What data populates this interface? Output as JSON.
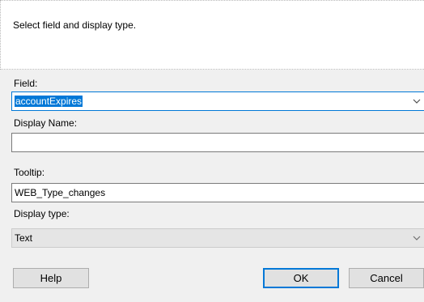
{
  "header": {
    "instruction": "Select field and display type."
  },
  "form": {
    "field": {
      "label": "Field:",
      "value": "accountExpires"
    },
    "display_name": {
      "label": "Display Name:",
      "value": ""
    },
    "tooltip": {
      "label": "Tooltip:",
      "value": "WEB_Type_changes"
    },
    "display_type": {
      "label": "Display type:",
      "value": "Text"
    }
  },
  "buttons": {
    "help": "Help",
    "ok": "OK",
    "cancel": "Cancel"
  },
  "icons": {
    "dropdown": "chevron-down-icon"
  },
  "colors": {
    "accent": "#0078d7",
    "dialog_background": "#f0f0f0"
  }
}
